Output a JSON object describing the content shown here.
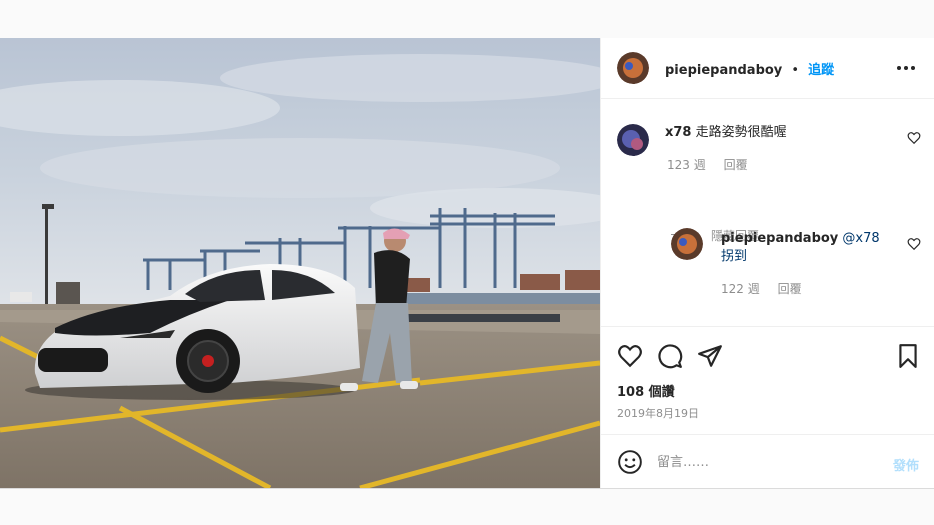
{
  "post": {
    "author": {
      "username": "piepiepandaboy",
      "separator": "•",
      "follow_label": "追蹤"
    },
    "more_icon": "more-horizontal-icon",
    "comments": [
      {
        "username": "x78",
        "text": "走路姿勢很酷喔",
        "age": "123 週",
        "reply_label": "回覆",
        "hide_replies_label": "隱藏回覆",
        "replies": [
          {
            "username": "piepiepandaboy",
            "text": "@x78 拐到",
            "age": "122 週",
            "reply_label": "回覆"
          }
        ]
      }
    ],
    "actions": {
      "like_icon": "heart-icon",
      "comment_icon": "comment-icon",
      "share_icon": "send-icon",
      "save_icon": "bookmark-icon"
    },
    "views": "108 個讚",
    "date": "2019年8月19日",
    "add_comment": {
      "emoji_icon": "smiley-icon",
      "placeholder": "留言……",
      "post_label": "發佈"
    },
    "colors": {
      "link_blue": "#0095f6",
      "disabled_blue": "#b2dffc",
      "muted": "#8e8e8e"
    }
  }
}
